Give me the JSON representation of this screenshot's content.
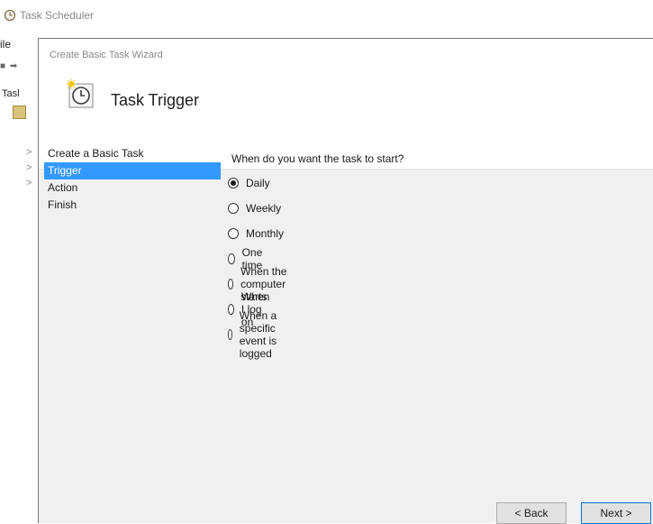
{
  "app": {
    "title": "Task Scheduler",
    "menu_file": "ile",
    "tree_label": "Tasl",
    "chevrons": [
      ">",
      ">",
      ">"
    ]
  },
  "dialog": {
    "title": "Create Basic Task Wizard",
    "header_title": "Task Trigger",
    "header_icon": "clock-trigger-icon",
    "steps": [
      {
        "label": "Create a Basic Task",
        "active": false
      },
      {
        "label": "Trigger",
        "active": true
      },
      {
        "label": "Action",
        "active": false
      },
      {
        "label": "Finish",
        "active": false
      }
    ],
    "question": "When do you want the task to start?",
    "options": [
      {
        "label": "Daily",
        "checked": true
      },
      {
        "label": "Weekly",
        "checked": false
      },
      {
        "label": "Monthly",
        "checked": false
      },
      {
        "label": "One time",
        "checked": false
      },
      {
        "label": "When the computer starts",
        "checked": false
      },
      {
        "label": "When I log on",
        "checked": false
      },
      {
        "label": "When a specific event is logged",
        "checked": false
      }
    ],
    "buttons": {
      "back": "< Back",
      "next": "Next >"
    }
  },
  "colors": {
    "selection": "#3399ff",
    "dialog_bg": "#f0f0f0",
    "accent_border": "#0078d7"
  }
}
